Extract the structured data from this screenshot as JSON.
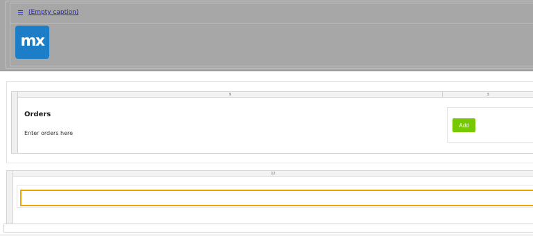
{
  "header": {
    "menu_icon": "hamburger-icon",
    "caption_link": "(Empty caption)",
    "logo_text": "mx",
    "logo_color": "#1b7ec6"
  },
  "layout_grid_1": {
    "column_labels": [
      "9",
      "3"
    ],
    "orders_title": "Orders",
    "orders_subtitle": "Enter orders here",
    "add_button_label": "Add",
    "add_button_color": "#76c800"
  },
  "layout_grid_2": {
    "column_labels": [
      "12"
    ],
    "input_value": "",
    "input_border_color": "#f0a400"
  }
}
